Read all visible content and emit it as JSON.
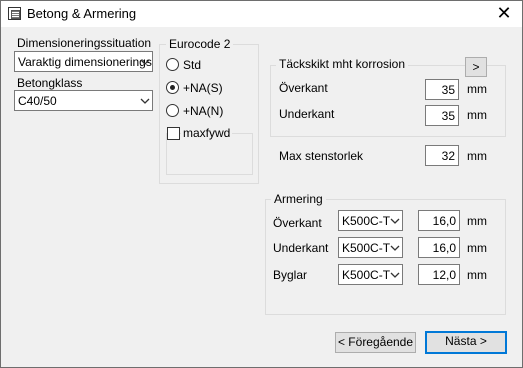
{
  "window": {
    "title": "Betong & Armering",
    "close_glyph": "✕"
  },
  "left": {
    "dim_label": "Dimensioneringssituation",
    "dim_value": "Varaktig dimensionerings",
    "betong_label": "Betongklass",
    "betong_value": "C40/50"
  },
  "eurocode": {
    "title": "Eurocode 2",
    "options": [
      "Std",
      "+NA(S)",
      "+NA(N)"
    ],
    "selected": "+NA(S)",
    "maxfywd_label": "maxfywd",
    "maxfywd_checked": false
  },
  "cover": {
    "title": "Täckskikt mht korrosion",
    "more_button": ">",
    "overkant_label": "Överkant",
    "overkant_value": "35",
    "underkant_label": "Underkant",
    "underkant_value": "35",
    "unit": "mm"
  },
  "stone": {
    "label": "Max stenstorlek",
    "value": "32",
    "unit": "mm"
  },
  "armering": {
    "title": "Armering",
    "rows": [
      {
        "label": "Överkant",
        "grade": "K500C-T",
        "value": "16,0",
        "unit": "mm"
      },
      {
        "label": "Underkant",
        "grade": "K500C-T",
        "value": "16,0",
        "unit": "mm"
      },
      {
        "label": "Byglar",
        "grade": "K500C-T",
        "value": "12,0",
        "unit": "mm"
      }
    ]
  },
  "buttons": {
    "prev": "< Föregående",
    "next": "Nästa >"
  },
  "icons": {
    "window": "app-window-icon",
    "dropdown": "chevron-down-icon"
  }
}
